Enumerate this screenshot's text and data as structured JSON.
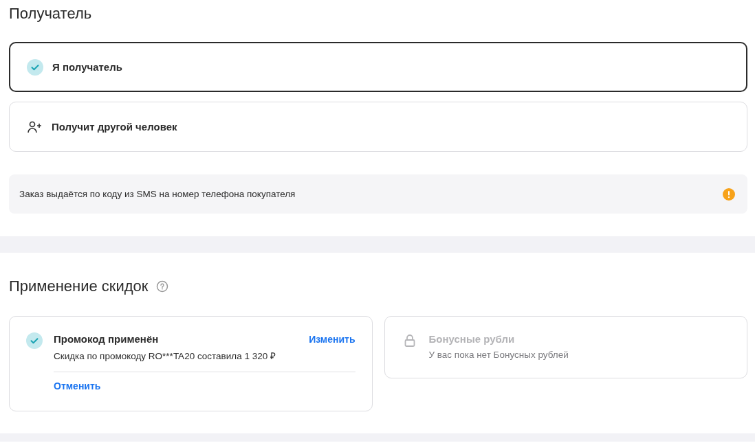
{
  "recipient": {
    "title": "Получатель",
    "options": [
      {
        "label": "Я получатель",
        "selected": true
      },
      {
        "label": "Получит другой человек",
        "selected": false
      }
    ],
    "note": "Заказ выдаётся по коду из SMS на номер телефона покупателя"
  },
  "discounts": {
    "title": "Применение скидок",
    "promo": {
      "title": "Промокод применён",
      "applied": true,
      "description": "Скидка по промокоду RO***TA20 составила 1 320 ₽",
      "change_link": "Изменить",
      "cancel_link": "Отменить"
    },
    "bonus": {
      "title": "Бонусные рубли",
      "disabled": true,
      "description": "У вас пока нет Бонусных рублей"
    }
  }
}
